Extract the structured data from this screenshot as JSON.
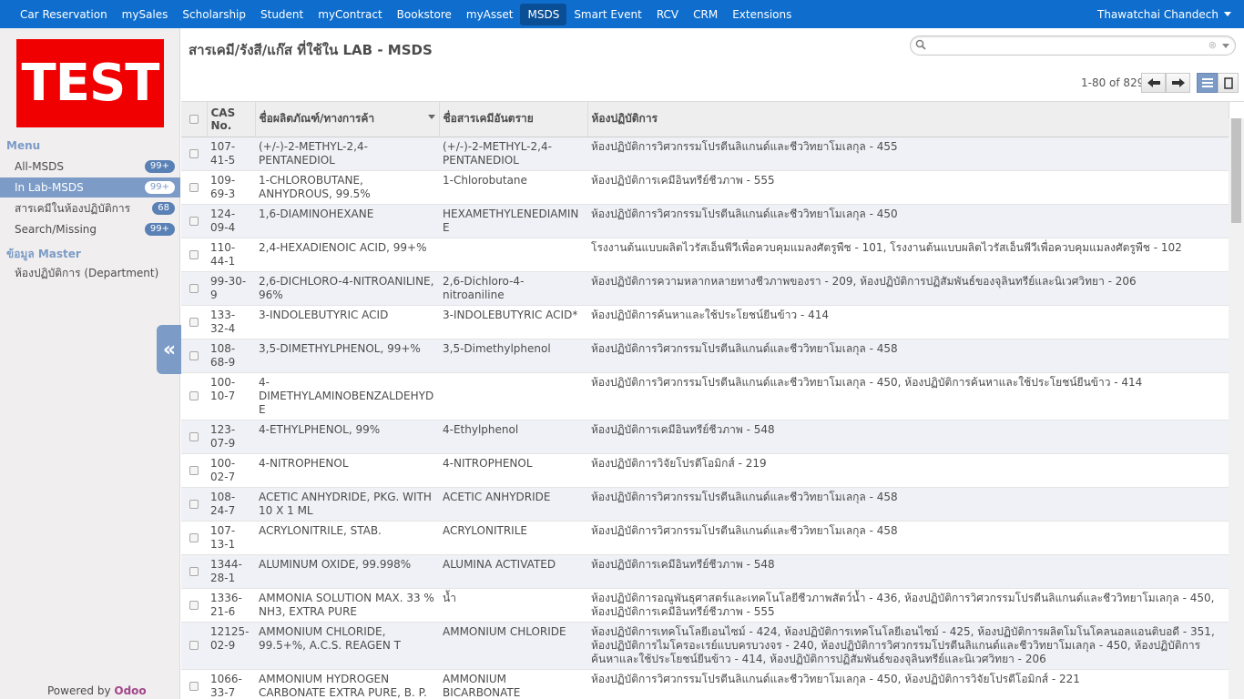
{
  "topbar": {
    "menus": [
      "Car Reservation",
      "mySales",
      "Scholarship",
      "Student",
      "myContract",
      "Bookstore",
      "myAsset",
      "MSDS",
      "Smart Event",
      "RCV",
      "CRM",
      "Extensions"
    ],
    "active_menu": "MSDS",
    "user": "Thawatchai Chandech"
  },
  "sidebar": {
    "logo_text": "TEST",
    "menu_title": "Menu",
    "items": [
      {
        "label": "All-MSDS",
        "badge": "99+"
      },
      {
        "label": "In Lab-MSDS",
        "badge": "99+"
      },
      {
        "label": "สารเคมีในห้องปฏิบัติการ",
        "badge": "68"
      },
      {
        "label": "Search/Missing",
        "badge": "99+"
      }
    ],
    "master_title": "ข้อมูล Master",
    "master_items": [
      {
        "label": "ห้องปฏิบัติการ (Department)"
      }
    ],
    "powered_by": "Powered by",
    "powered_brand": "Odoo",
    "collapse_icon": "double-chevron-left-icon"
  },
  "main": {
    "title": "สารเคมี/รังสี/แก๊ส ที่ใช้ใน LAB - MSDS",
    "search": {
      "placeholder": "",
      "value": ""
    },
    "pager": "1-80 of 829"
  },
  "table": {
    "columns": [
      "CAS No.",
      "ชื่อผลิตภัณฑ์/ทางการค้า",
      "ชื่อสารเคมีอันตราย",
      "ห้องปฏิบัติการ"
    ],
    "rows": [
      {
        "cas": "107-41-5",
        "product": "(+/-)-2-METHYL-2,4-PENTANEDIOL",
        "chemical": "(+/-)-2-METHYL-2,4-PENTANEDIOL",
        "lab": "ห้องปฏิบัติการวิศวกรรมโปรตีนลิแกนด์และชีววิทยาโมเลกุล - 455"
      },
      {
        "cas": "109-69-3",
        "product": "1-CHLOROBUTANE, ANHYDROUS, 99.5%",
        "chemical": "1-Chlorobutane",
        "lab": "ห้องปฏิบัติการเคมีอินทรีย์ชีวภาพ - 555"
      },
      {
        "cas": "124-09-4",
        "product": "1,6-DIAMINOHEXANE",
        "chemical": "HEXAMETHYLENEDIAMINE",
        "lab": "ห้องปฏิบัติการวิศวกรรมโปรตีนลิแกนด์และชีววิทยาโมเลกุล - 450"
      },
      {
        "cas": "110-44-1",
        "product": "2,4-HEXADIENOIC ACID, 99+%",
        "chemical": "",
        "lab": "โรงงานต้นแบบผลิตไวรัสเอ็นพีวีเพื่อควบคุมแมลงศัตรูพืช - 101, โรงงานต้นแบบผลิตไวรัสเอ็นพีวีเพื่อควบคุมแมลงศัตรูพืช - 102"
      },
      {
        "cas": "99-30-9",
        "product": "2,6-DICHLORO-4-NITROANILINE, 96%",
        "chemical": "2,6-Dichloro-4-nitroaniline",
        "lab": "ห้องปฏิบัติการความหลากหลายทางชีวภาพของรา - 209, ห้องปฏิบัติการปฏิสัมพันธ์ของจุลินทรีย์และนิเวศวิทยา - 206"
      },
      {
        "cas": "133-32-4",
        "product": "3-INDOLEBUTYRIC ACID",
        "chemical": "3-INDOLEBUTYRIC ACID*",
        "lab": "ห้องปฏิบัติการค้นหาและใช้ประโยชน์ยีนข้าว - 414"
      },
      {
        "cas": "108-68-9",
        "product": "3,5-DIMETHYLPHENOL, 99+%",
        "chemical": "3,5-Dimethylphenol",
        "lab": "ห้องปฏิบัติการวิศวกรรมโปรตีนลิแกนด์และชีววิทยาโมเลกุล - 458"
      },
      {
        "cas": "100-10-7",
        "product": "4-DIMETHYLAMINOBENZALDEHYDE",
        "chemical": "",
        "lab": "ห้องปฏิบัติการวิศวกรรมโปรตีนลิแกนด์และชีววิทยาโมเลกุล - 450, ห้องปฏิบัติการค้นหาและใช้ประโยชน์ยีนข้าว - 414"
      },
      {
        "cas": "123-07-9",
        "product": "4-ETHYLPHENOL, 99%",
        "chemical": "4-Ethylphenol",
        "lab": "ห้องปฏิบัติการเคมีอินทรีย์ชีวภาพ - 548"
      },
      {
        "cas": "100-02-7",
        "product": "4-NITROPHENOL",
        "chemical": "4-NITROPHENOL",
        "lab": "ห้องปฏิบัติการวิจัยโปรตีโอมิกส์ - 219"
      },
      {
        "cas": "108-24-7",
        "product": "ACETIC ANHYDRIDE, PKG. WITH 10 X 1 ML",
        "chemical": "ACETIC ANHYDRIDE",
        "lab": "ห้องปฏิบัติการวิศวกรรมโปรตีนลิแกนด์และชีววิทยาโมเลกุล - 458"
      },
      {
        "cas": "107-13-1",
        "product": "ACRYLONITRILE, STAB.",
        "chemical": "ACRYLONITRILE",
        "lab": "ห้องปฏิบัติการวิศวกรรมโปรตีนลิแกนด์และชีววิทยาโมเลกุล - 458"
      },
      {
        "cas": "1344-28-1",
        "product": "ALUMINUM OXIDE, 99.998%",
        "chemical": "ALUMINA ACTIVATED",
        "lab": "ห้องปฏิบัติการเคมีอินทรีย์ชีวภาพ - 548"
      },
      {
        "cas": "1336-21-6",
        "product": "AMMONIA SOLUTION MAX. 33 % NH3, EXTRA PURE",
        "chemical": "น้ำ",
        "lab": "ห้องปฏิบัติการอณูพันธุศาสตร์และเทคโนโลยีชีวภาพสัตว์น้ำ - 436, ห้องปฏิบัติการวิศวกรรมโปรตีนลิแกนด์และชีววิทยาโมเลกุล - 450, ห้องปฏิบัติการเคมีอินทรีย์ชีวภาพ - 555"
      },
      {
        "cas": "12125-02-9",
        "product": "AMMONIUM CHLORIDE, 99.5+%, A.C.S. REAGEN T",
        "chemical": "AMMONIUM CHLORIDE",
        "lab": "ห้องปฏิบัติการเทคโนโลยีเอนไซม์ - 424, ห้องปฏิบัติการเทคโนโลยีเอนไซม์ - 425, ห้องปฏิบัติการผลิตโมโนโคลนอลแอนติบอดี - 351, ห้องปฏิบัติการไมโครอะเรย์แบบครบวงจร - 240, ห้องปฏิบัติการวิศวกรรมโปรตีนลิแกนด์และชีววิทยาโมเลกุล - 450, ห้องปฏิบัติการค้นหาและใช้ประโยชน์ยีนข้าว - 414, ห้องปฏิบัติการปฏิสัมพันธ์ของจุลินทรีย์และนิเวศวิทยา - 206"
      },
      {
        "cas": "1066-33-7",
        "product": "AMMONIUM HYDROGEN CARBONATE EXTRA PURE, B. P.",
        "chemical": "AMMONIUM BICARBONATE",
        "lab": "ห้องปฏิบัติการวิศวกรรมโปรตีนลิแกนด์และชีววิทยาโมเลกุล - 450, ห้องปฏิบัติการวิจัยโปรตีโอมิกส์ - 221"
      }
    ]
  }
}
